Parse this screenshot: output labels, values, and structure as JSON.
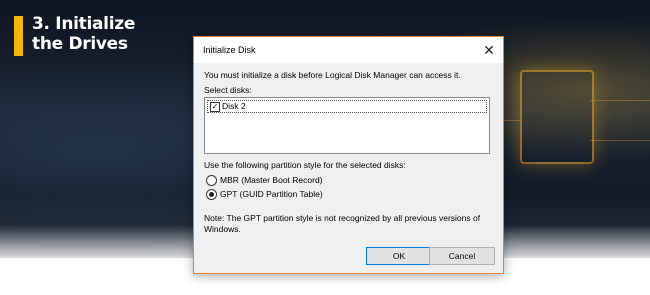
{
  "banner": {
    "line1": "3. Initialize",
    "line2": "the Drives",
    "accent_color": "#f2b705"
  },
  "dialog": {
    "title": "Initialize Disk",
    "close_icon": "close-icon",
    "intro": "You must initialize a disk before Logical Disk Manager can access it.",
    "select_label": "Select disks:",
    "disks": [
      {
        "label": "Disk 2",
        "checked": true
      }
    ],
    "partition_label": "Use the following partition style for the selected disks:",
    "options": [
      {
        "label": "MBR (Master Boot Record)",
        "selected": false
      },
      {
        "label": "GPT (GUID Partition Table)",
        "selected": true
      }
    ],
    "note_line1": "Note: The GPT partition style is not recognized by all previous versions of",
    "note_line2": "Windows.",
    "ok_label": "OK",
    "cancel_label": "Cancel"
  }
}
